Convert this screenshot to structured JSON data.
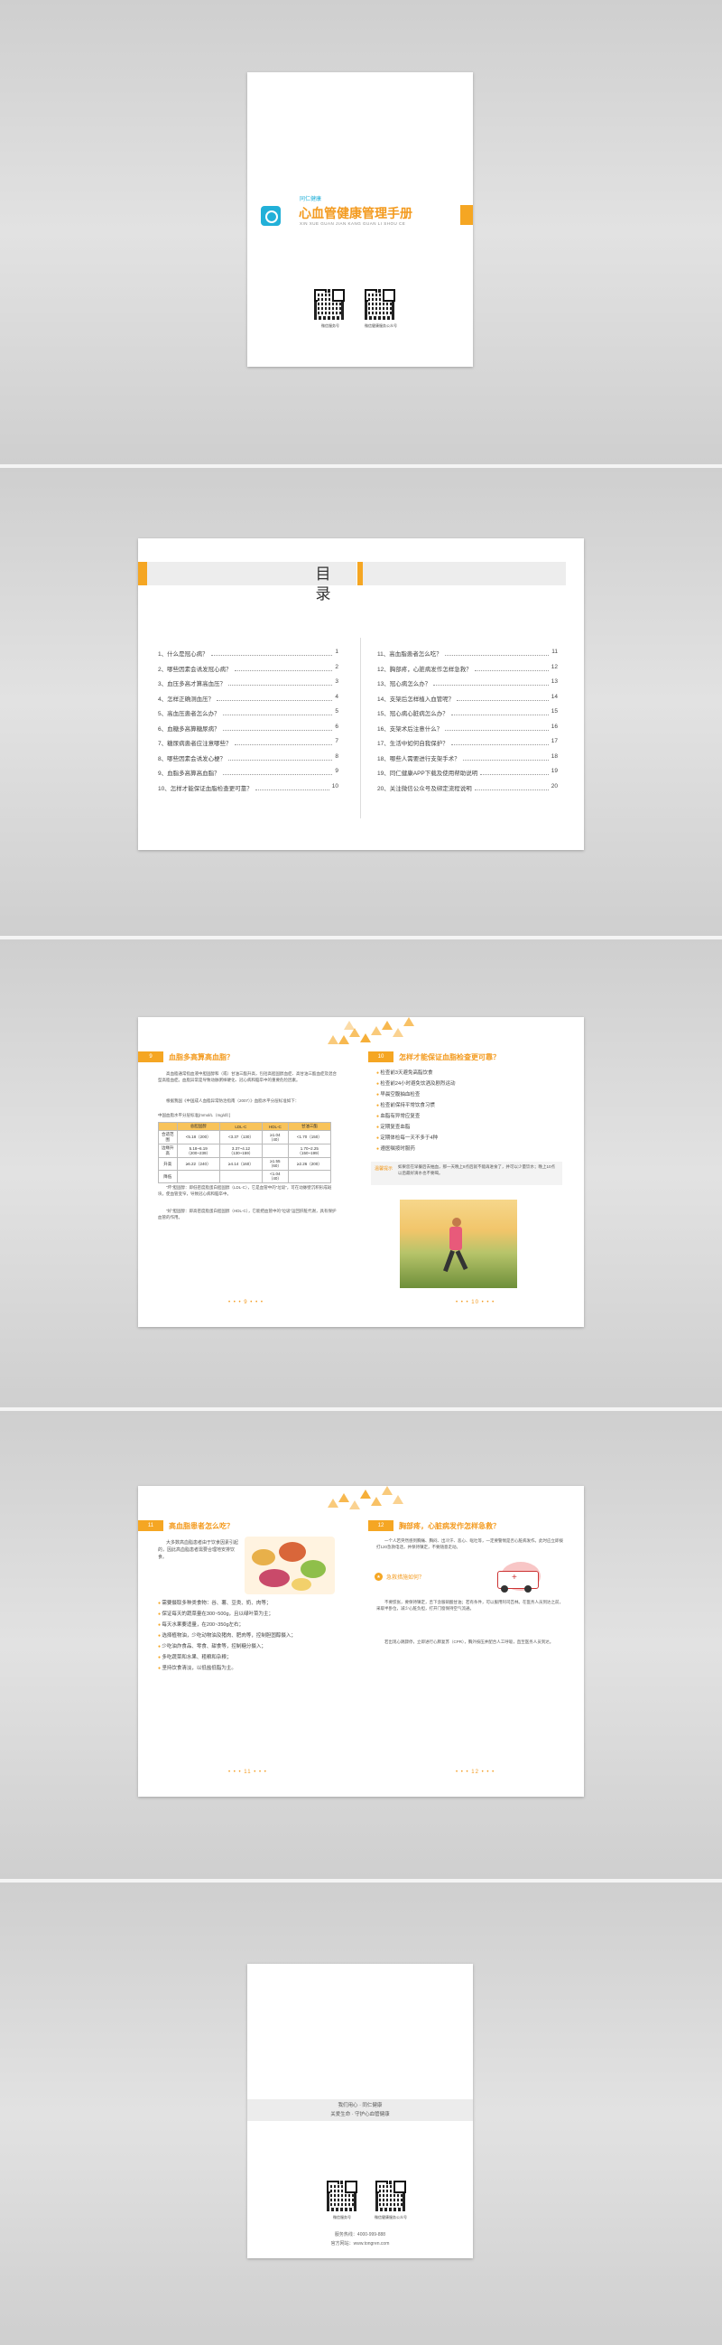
{
  "cover": {
    "brand_small": "同仁健康",
    "title": "心血管健康管理手册",
    "pinyin": "XIN XUE GUAN JIAN KANG GUAN LI SHOU CE",
    "qr_caption_left": "微信服务号",
    "qr_caption_right": "微信健康服务公众号"
  },
  "toc": {
    "title": "目 录",
    "left": [
      {
        "label": "1、什么是冠心病？",
        "page": "1"
      },
      {
        "label": "2、哪些因素会诱发冠心病？",
        "page": "2"
      },
      {
        "label": "3、血压多高才算高血压？",
        "page": "3"
      },
      {
        "label": "4、怎样正确测血压？",
        "page": "4"
      },
      {
        "label": "5、高血压患者怎么办？",
        "page": "5"
      },
      {
        "label": "6、血糖多高算糖尿病？",
        "page": "6"
      },
      {
        "label": "7、糖尿病患者应注意哪些？",
        "page": "7"
      },
      {
        "label": "8、哪些因素会诱发心梗？",
        "page": "8"
      },
      {
        "label": "9、血脂多高算高血脂？",
        "page": "9"
      },
      {
        "label": "10、怎样才能保证血脂检查更可靠？",
        "page": "10"
      }
    ],
    "right": [
      {
        "label": "11、高血脂患者怎么吃？",
        "page": "11"
      },
      {
        "label": "12、胸部疼，心脏病发作怎样急救？",
        "page": "12"
      },
      {
        "label": "13、冠心病怎么办？",
        "page": "13"
      },
      {
        "label": "14、支架后怎样植入血管呢？",
        "page": "14"
      },
      {
        "label": "15、冠心病心脏病怎么办？",
        "page": "15"
      },
      {
        "label": "16、支架术后注意什么？",
        "page": "16"
      },
      {
        "label": "17、生活中如何自我保护？",
        "page": "17"
      },
      {
        "label": "18、哪些人需要进行支架手术？",
        "page": "18"
      },
      {
        "label": "19、同仁健康APP下载及使用帮助说明",
        "page": "19"
      },
      {
        "label": "20、关注微信公众号及绑定流程说明",
        "page": "20"
      }
    ]
  },
  "spread1": {
    "left_num": "9",
    "left_title": "血脂多高算高血脂？",
    "left_body": "高血脂通常指血液中胆固醇和（或）甘油三酯升高，包括高胆固醇血症、高甘油三酯血症及混合型高脂血症。血脂异常是导致动脉粥样硬化、冠心病和脑卒中的重要危险因素。",
    "left_body2": "根据我国《中国成人血脂异常防治指南（2007）》血脂水平分层标准如下：",
    "table_caption": "中国血脂水平分层标准[mmol/L（mg/dl）]",
    "table_head": [
      "",
      "总胆固醇",
      "LDL-C",
      "HDL-C",
      "甘油三酯"
    ],
    "table_rows": [
      [
        "合适范围",
        "<5.18（200）",
        "<3.37（130）",
        "≥1.04（40）",
        "<1.70（150）"
      ],
      [
        "边缘升高",
        "5.18~6.19（200~239）",
        "3.37~4.12（130~159）",
        "",
        "1.70~2.25（150~199）"
      ],
      [
        "升高",
        "≥6.22（240）",
        "≥4.14（160）",
        "≥1.55（60）",
        "≥2.26（200）"
      ],
      [
        "降低",
        "",
        "",
        "<1.04（40）",
        ""
      ]
    ],
    "left_p3": "“坏”胆固醇：即低密度脂蛋白胆固醇（LDL-C），它是血管中的“垃圾”，可在动脉壁沉积形成斑块，使血管变窄，导致冠心病和脑卒中。",
    "left_p4": "“好”胆固醇：即高密度脂蛋白胆固醇（HDL-C），它能把血管中的“垃圾”运回肝脏代谢，具有保护血管的作用。",
    "right_num": "10",
    "right_title": "怎样才能保证血脂检查更可靠？",
    "right_list": [
      "检查前3天避免高脂饮食",
      "检查前24小时避免饮酒及剧烈运动",
      "早晨空腹抽血检查",
      "检查前保持平常饮食习惯",
      "血脂有异常应复查",
      "定期复查血脂",
      "定期体检每一天不多于4种",
      "遵医嘱按时服药"
    ],
    "right_note_label": "温馨提示",
    "right_note": "如果您在早餐后去抽血，那一天晚上8点后就不能再进食了，并可以少量饮水；晚上10点以后最好滴水也不要喝。",
    "foot_left": "• • • 9 • • •",
    "foot_right": "• • • 10 • • •"
  },
  "spread2": {
    "left_num": "11",
    "left_title": "高血脂患者怎么吃？",
    "left_body": "大多数高血脂患者由于饮食因素引起的，因此高血脂患者需要合理地安排饮食。",
    "left_list": [
      "需要摄取多种类食物：谷、薯、豆类、奶、肉等；",
      "保证每天的蔬菜量在300~500g，且以绿叶菜为主；",
      "每天水果要适量，在200~350g左右；",
      "选择植物油，少吃动物油及猪肉、肥肉等，控制胆固醇摄入；",
      "少吃油炸食品、零食、甜食等，控制糖分摄入；",
      "多吃蔬菜和水果、粗粮和杂粮；",
      "坚持饮食清淡，以低盐低脂为主。"
    ],
    "right_num": "12",
    "right_title": "胸部疼，心脏病发作怎样急救？",
    "right_body": "一个人若突然感到胸痛、胸闷、出冷汗、恶心、呕吐等，一定要警惕是否心脏病发作。此时应立即拨打120急救电话，并保持镇定，不要随意走动。",
    "right_sub": "急救措施如何？",
    "right_body2": "不要慌张，要保持镇定，舌下含服硝酸甘油；若有条件，可以服用阿司匹林。在医务人员到达之前，采取半卧位，减少心脏负担，打开门窗保持空气流通。",
    "right_body3": "若出现心跳骤停，立即进行心肺复苏（CPR），胸外按压并配合人工呼吸，直至医务人员到达。",
    "foot_left": "• • • 11 • • •",
    "foot_right": "• • • 12 • • •"
  },
  "back": {
    "slogan1": "我们用心 · 同仁健康",
    "slogan2": "关爱生命 · 守护心血管健康",
    "qr_caption_left": "微信服务号",
    "qr_caption_right": "微信健康服务公众号",
    "hotline": "服务热线：4000-999-888",
    "website": "官方网站：www.tongren.com"
  }
}
